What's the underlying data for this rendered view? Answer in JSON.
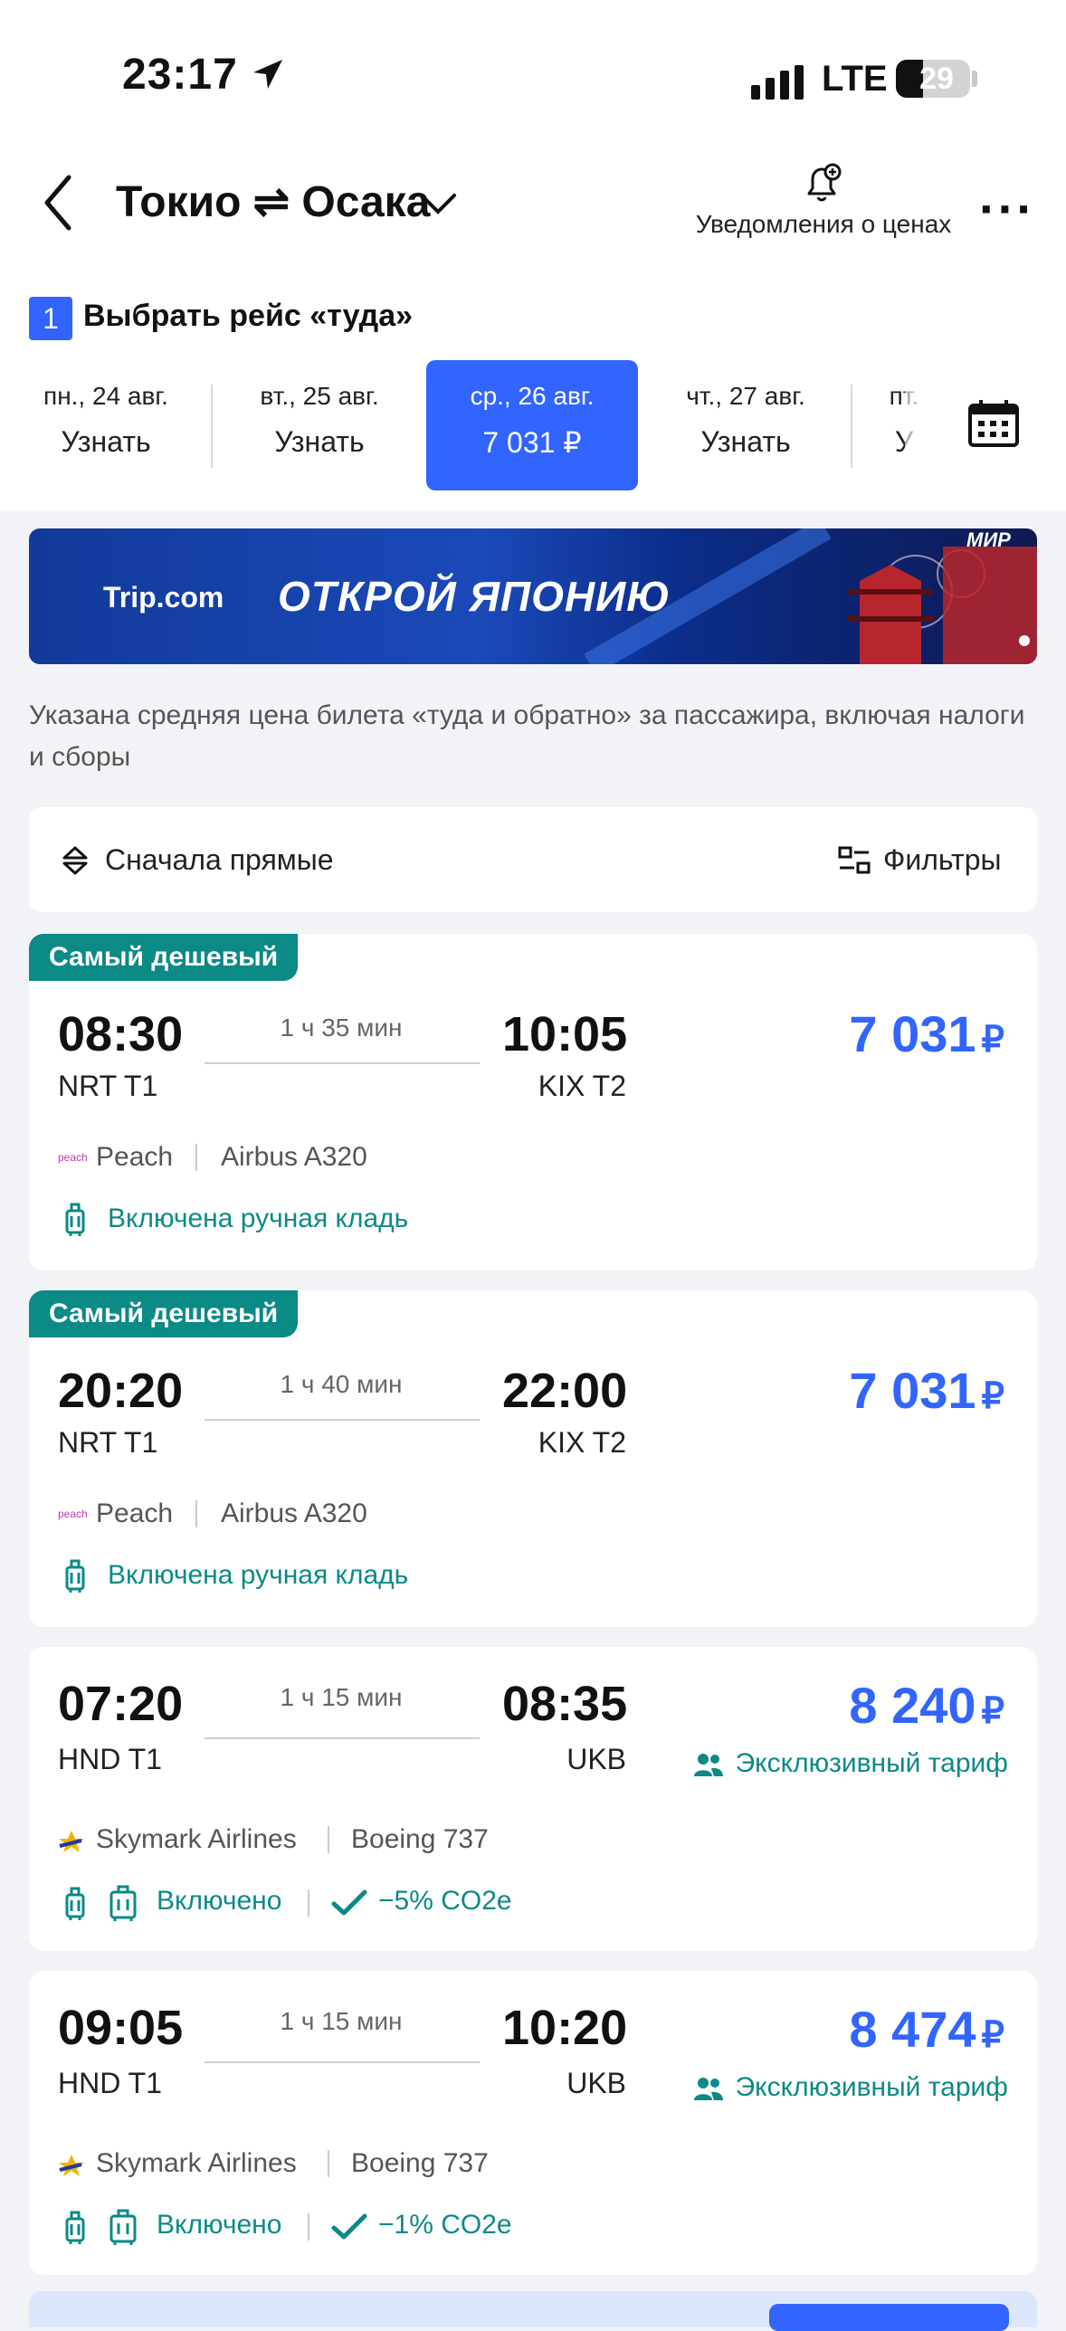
{
  "status": {
    "time": "23:17",
    "network": "LTE",
    "battery": "29"
  },
  "header": {
    "route": "Токио ⇌ Осака",
    "notify_label": "Уведомления о ценах"
  },
  "step": {
    "number": "1",
    "title": "Выбрать рейс «туда»"
  },
  "dates": [
    {
      "day": "пн., 24 авг.",
      "price": "Узнать",
      "active": false
    },
    {
      "day": "вт., 25 авг.",
      "price": "Узнать",
      "active": false
    },
    {
      "day": "ср., 26 авг.",
      "price": "7 031 ₽",
      "active": true
    },
    {
      "day": "чт., 27 авг.",
      "price": "Узнать",
      "active": false
    },
    {
      "day": "пт.",
      "price": "У",
      "active": false
    }
  ],
  "banner": {
    "brand": "Trip.com",
    "text": "ОТКРОЙ ЯПОНИЮ",
    "corner": "МИР"
  },
  "note": "Указана средняя цена билета «туда и обратно» за пассажира, включая налоги и сборы",
  "sort": {
    "label": "Сначала прямые",
    "filters": "Фильтры"
  },
  "flights": [
    {
      "tag": "Самый дешевый",
      "dep": "08:30",
      "arr": "10:05",
      "duration": "1 ч 35 мин",
      "from": "NRT T1",
      "to": "KIX T2",
      "price": "7 031",
      "currency": "₽",
      "airline": "Peach",
      "logo_text": "peach",
      "aircraft": "Airbus A320",
      "amenity": "Включена ручная кладь"
    },
    {
      "tag": "Самый дешевый",
      "dep": "20:20",
      "arr": "22:00",
      "duration": "1 ч 40 мин",
      "from": "NRT T1",
      "to": "KIX T2",
      "price": "7 031",
      "currency": "₽",
      "airline": "Peach",
      "logo_text": "peach",
      "aircraft": "Airbus A320",
      "amenity": "Включена ручная кладь"
    },
    {
      "dep": "07:20",
      "arr": "08:35",
      "duration": "1 ч 15 мин",
      "from": "HND T1",
      "to": "UKB",
      "price": "8 240",
      "currency": "₽",
      "exclusive": "Эксклюзивный тариф",
      "airline": "Skymark Airlines",
      "aircraft": "Boeing 737",
      "amenity": "Включено",
      "co2": "−5% CO2e"
    },
    {
      "dep": "09:05",
      "arr": "10:20",
      "duration": "1 ч 15 мин",
      "from": "HND T1",
      "to": "UKB",
      "price": "8 474",
      "currency": "₽",
      "exclusive": "Эксклюзивный тариф",
      "airline": "Skymark Airlines",
      "aircraft": "Boeing 737",
      "amenity": "Включено",
      "co2": "−1% CO2e"
    }
  ],
  "colors": {
    "accent": "#3264ff",
    "teal": "#0b8a86",
    "background": "#f2f3f7"
  }
}
